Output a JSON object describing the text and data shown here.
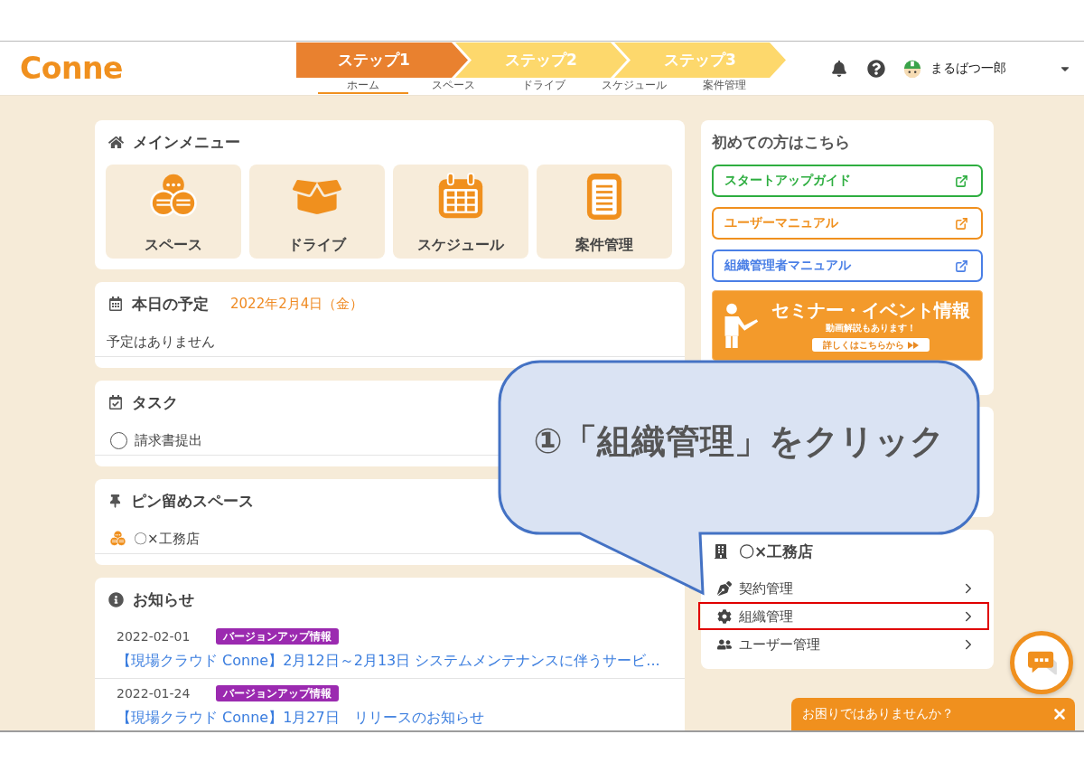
{
  "header": {
    "logo": "Conne",
    "steps": [
      {
        "label": "ステップ1",
        "selected": true
      },
      {
        "label": "ステップ2",
        "selected": false
      },
      {
        "label": "ステップ3",
        "selected": false
      }
    ],
    "nav": [
      {
        "label": "ホーム",
        "selected": true
      },
      {
        "label": "スペース",
        "selected": false
      },
      {
        "label": "ドライブ",
        "selected": false
      },
      {
        "label": "スケジュール",
        "selected": false
      },
      {
        "label": "案件管理",
        "selected": false
      }
    ],
    "user_name": "まるばつ一郎"
  },
  "main_menu": {
    "title": "メインメニュー",
    "tiles": [
      {
        "label": "スペース",
        "kind": "space"
      },
      {
        "label": "ドライブ",
        "kind": "drive"
      },
      {
        "label": "スケジュール",
        "kind": "schedule"
      },
      {
        "label": "案件管理",
        "kind": "project"
      }
    ]
  },
  "today": {
    "title": "本日の予定",
    "date": "2022年2月4日（金）",
    "empty_message": "予定はありません"
  },
  "tasks": {
    "title": "タスク",
    "items": [
      {
        "label": "請求書提出",
        "checked": false
      }
    ]
  },
  "pinned": {
    "title": "ピン留めスペース",
    "items": [
      {
        "label": "〇×工務店"
      }
    ]
  },
  "news": {
    "title": "お知らせ",
    "items": [
      {
        "date": "2022-02-01",
        "tag": "バージョンアップ情報",
        "title": "【現場クラウド Conne】2月12日～2月13日 システムメンテナンスに伴うサービ..."
      },
      {
        "date": "2022-01-24",
        "tag": "バージョンアップ情報",
        "title": "【現場クラウド Conne】1月27日　リリースのお知らせ"
      }
    ]
  },
  "guide": {
    "title": "初めての方はこちら",
    "links": [
      {
        "label": "スタートアップガイド",
        "color": "#2eae40"
      },
      {
        "label": "ユーザーマニュアル",
        "color": "#f0901e"
      },
      {
        "label": "組織管理者マニュアル",
        "color": "#4a7fe6"
      }
    ],
    "banner": {
      "title": "セミナー・イベント情報",
      "subtitle": "動画解説もあります！",
      "button": "詳しくはこちらから"
    }
  },
  "organization": {
    "name": "〇×工務店",
    "items": [
      {
        "label": "契約管理",
        "kind": "contract",
        "highlighted": false
      },
      {
        "label": "組織管理",
        "kind": "settings",
        "highlighted": true
      },
      {
        "label": "ユーザー管理",
        "kind": "users",
        "highlighted": false
      }
    ]
  },
  "callout": {
    "text": "①「組織管理」をクリック"
  },
  "help_bar": {
    "text": "お困りではありませんか？"
  }
}
